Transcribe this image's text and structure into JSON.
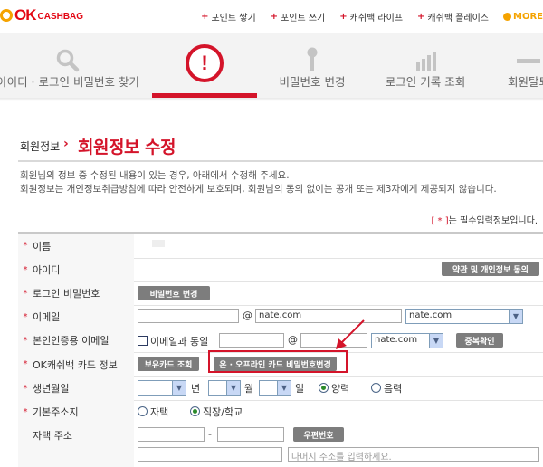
{
  "brand": {
    "logo_text": "OK",
    "logo_sub": "CASHBAG"
  },
  "top_nav": [
    {
      "label": "포인트 쌓기"
    },
    {
      "label": "포인트 쓰기"
    },
    {
      "label": "캐쉬백 라이프"
    },
    {
      "label": "캐쉬백 플레이스"
    },
    {
      "label": "MORE"
    }
  ],
  "tabs": [
    {
      "label": "아이디 · 로그인 비밀번호 찾기",
      "icon": "search-icon"
    },
    {
      "label": "",
      "icon": "alert-icon",
      "active": true
    },
    {
      "label": "비밀번호 변경",
      "icon": "key-icon"
    },
    {
      "label": "로그인 기록 조회",
      "icon": "bar-chart-icon"
    },
    {
      "label": "회원탈퇴",
      "icon": "minus-icon"
    }
  ],
  "breadcrumb": {
    "parent": "회원정보",
    "separator": "›"
  },
  "page_title": "회원정보 수정",
  "description": [
    "회원님의 정보 중 수정된 내용이 있는 경우, 아래에서 수정해 주세요.",
    "회원정보는 개인정보취급방침에 따라 안전하게 보호되며, 회원님의 동의 없이는 공개 또는 제3자에게 제공되지 않습니다."
  ],
  "required_note": {
    "mark": "[ * ]",
    "text": "는 필수입력정보입니다."
  },
  "form": {
    "rows": [
      {
        "label": "이름",
        "required": true
      },
      {
        "label": "아이디",
        "required": true,
        "button": "약관 및 개인정보 동의"
      },
      {
        "label": "로그인 비밀번호",
        "required": true,
        "button": "비밀번호 변경"
      },
      {
        "label": "이메일",
        "required": true,
        "at": "@",
        "domain_value": "nate.com",
        "domain_select": "nate.com"
      },
      {
        "label": "본인인증용 이메일",
        "required": true,
        "checkbox_label": "이메일과 동일",
        "at": "@",
        "domain_select": "nate.com",
        "button": "중복확인"
      },
      {
        "label": "OK캐쉬백 카드 정보",
        "required": true,
        "button_1": "보유카드 조회",
        "button_2": "온 · 오프라인 카드 비밀번호변경"
      },
      {
        "label": "생년월일",
        "required": true,
        "year_unit": "년",
        "month_unit": "월",
        "day_unit": "일",
        "radio_1": "양력",
        "radio_2": "음력",
        "selected": "양력"
      },
      {
        "label": "기본주소지",
        "required": true,
        "radio_1": "자택",
        "radio_2": "직장/학교",
        "selected": "직장/학교"
      },
      {
        "label": "자택 주소",
        "required": false,
        "dash": "-",
        "button": "우편번호",
        "detail_placeholder": "나머지 주소를 입력하세요."
      }
    ]
  },
  "colors": {
    "accent": "#d4142a",
    "logo_orange": "#f5a300",
    "button_gray": "#7d7d7d"
  }
}
